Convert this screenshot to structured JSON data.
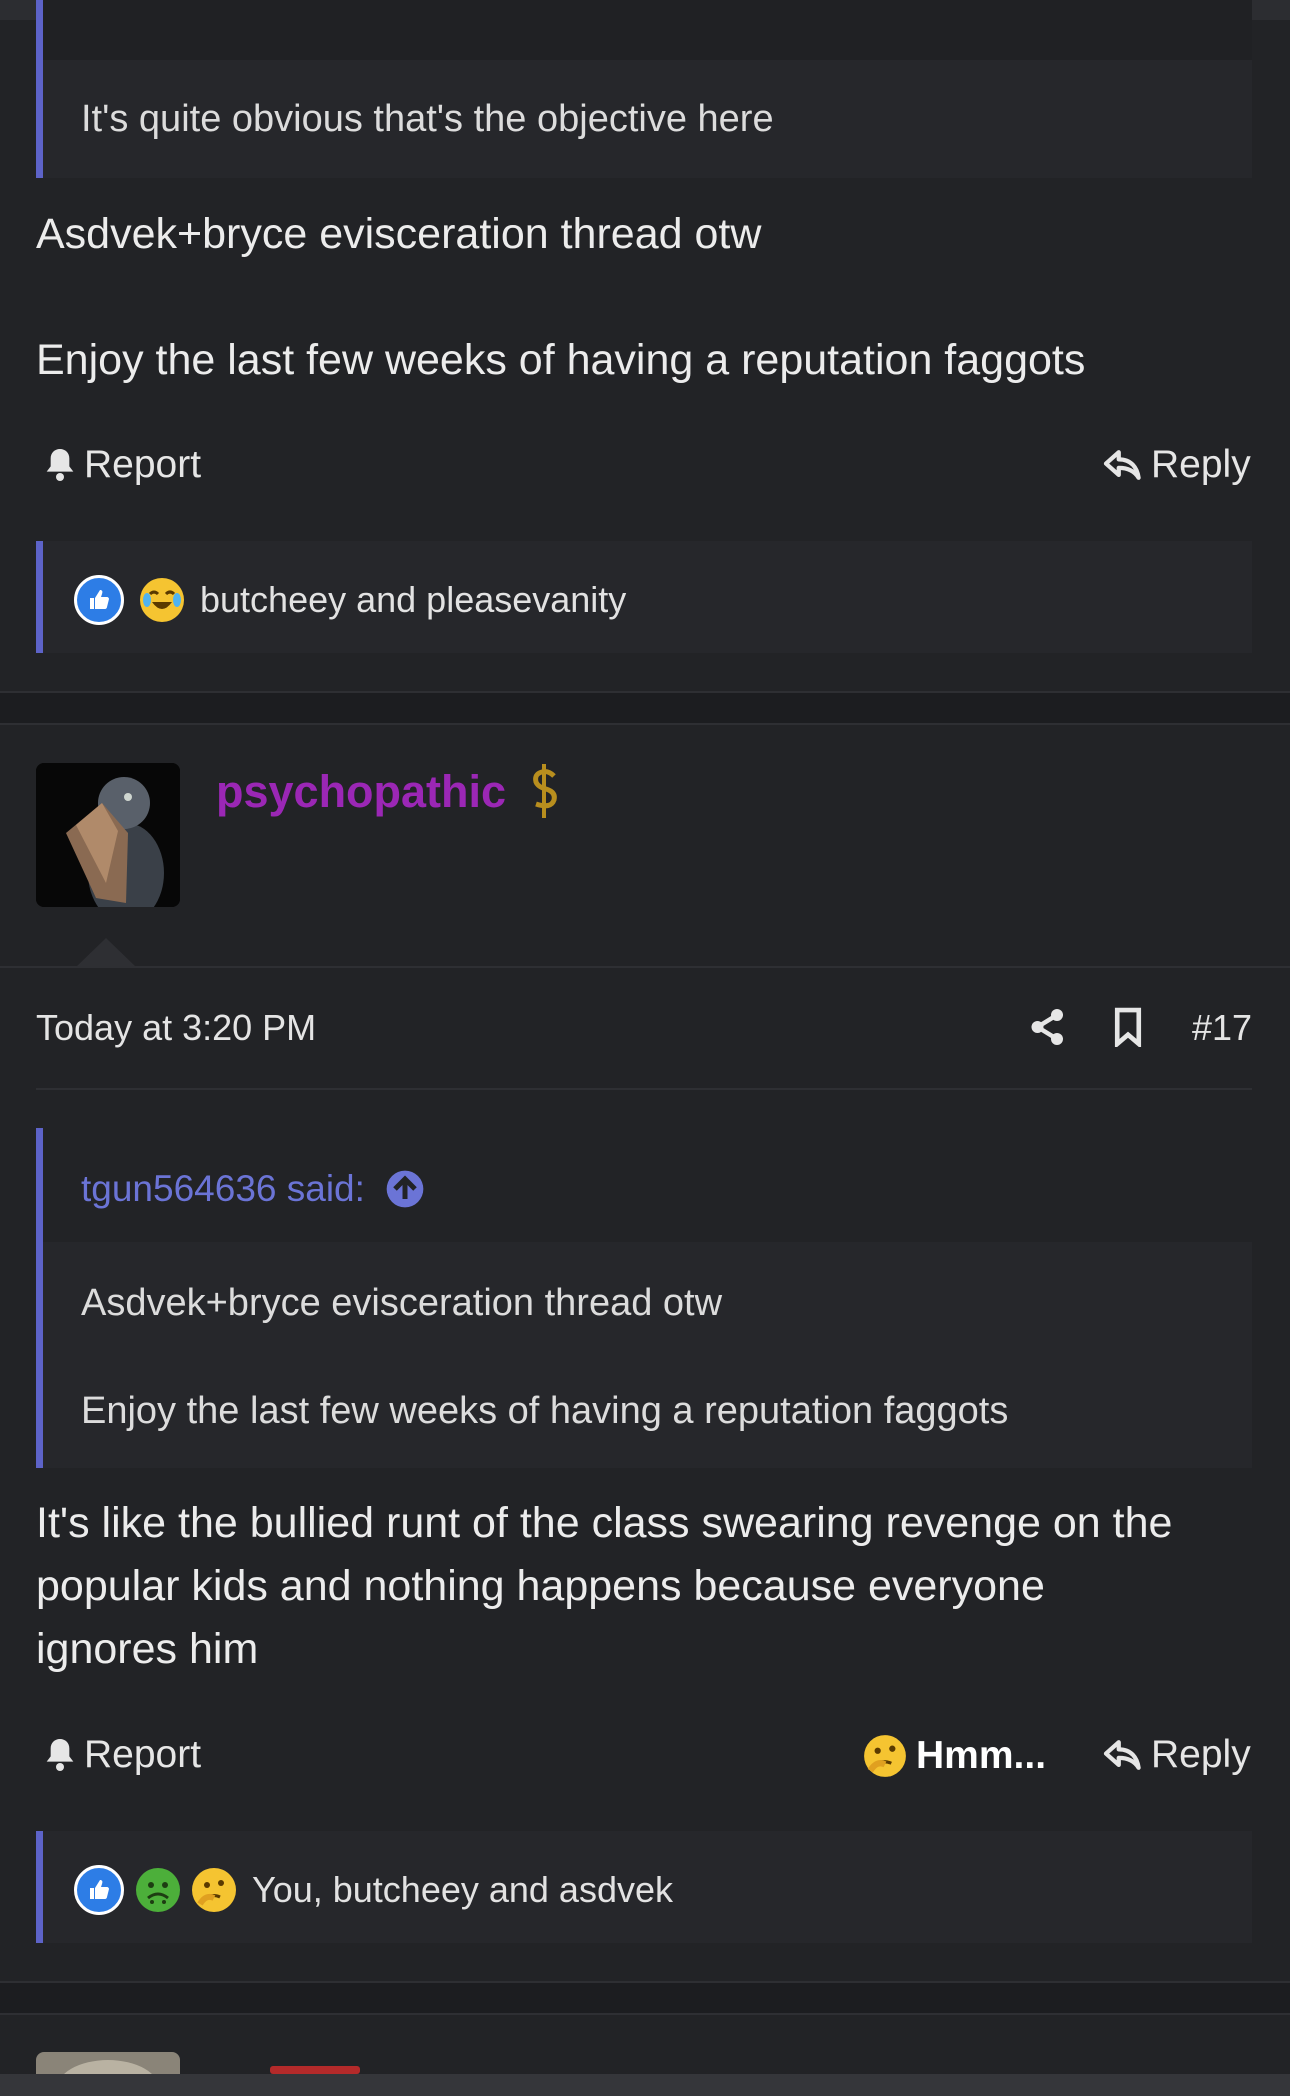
{
  "post16": {
    "quote_text": "It's quite obvious that's the objective here",
    "body_line1": "Asdvek+bryce evisceration thread otw",
    "body_line2": "Enjoy the last few weeks of having a reputation faggots",
    "report_label": "Report",
    "reply_label": "Reply",
    "reactions_text": "butcheey and pleasevanity",
    "reaction_icons": [
      "like-icon",
      "laugh-cry-icon"
    ]
  },
  "post17": {
    "username": "psychopathic",
    "username_color": "#9b27b5",
    "badge_icon": "dollar-badge-icon",
    "timestamp": "Today at 3:20 PM",
    "post_number": "#17",
    "quote_author": "tgun564636 said:",
    "quote_line1": "Asdvek+bryce evisceration thread otw",
    "quote_line2": "Enjoy the last few weeks of having a reputation faggots",
    "body_line1": "It's like the bullied runt of the class swearing revenge on the",
    "body_line2": "popular kids and nothing happens because everyone",
    "body_line3": "ignores him",
    "report_label": "Report",
    "hmm_label": "Hmm...",
    "reply_label": "Reply",
    "reactions_text": "You, butcheey and asdvek",
    "reaction_icons": [
      "like-icon",
      "sick-icon",
      "thinking-icon"
    ]
  },
  "colors": {
    "accent": "#5d63c8",
    "quote_link": "#6b74d6",
    "background": "#222326"
  }
}
